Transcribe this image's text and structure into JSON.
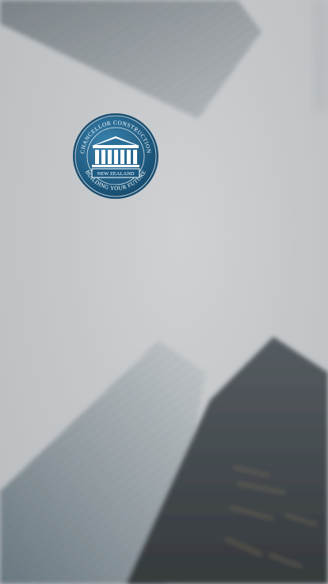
{
  "app": {
    "name": "Chancellor Construction",
    "screen": "splash"
  },
  "logo": {
    "top_text": "CHANCELLOR  CONSTRUCTION",
    "banner_text": "NEW ZEALAND",
    "bottom_text": "BUILDING YOUR FUTURE",
    "icon": "classical-building-icon"
  },
  "background": {
    "icon": "foggy-skyscrapers-photo"
  },
  "colors": {
    "badge_outer": "#1d5a82",
    "badge_inner": "#2a6f9a",
    "badge_text": "#ffffff",
    "sky": "#c8cacd",
    "building_dark": "#1c2126"
  }
}
